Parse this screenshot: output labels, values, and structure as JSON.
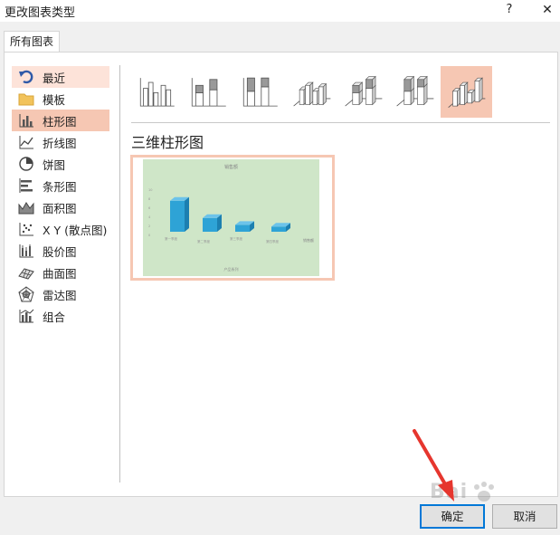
{
  "window": {
    "title": "更改图表类型",
    "help_label": "?",
    "close_label": "✕"
  },
  "tab": {
    "label": "所有图表"
  },
  "sidebar": {
    "items": [
      {
        "label": "最近",
        "icon": "undo-arrow-icon",
        "state": "hover"
      },
      {
        "label": "模板",
        "icon": "folder-icon",
        "state": "normal"
      },
      {
        "label": "柱形图",
        "icon": "column-chart-icon",
        "state": "selected"
      },
      {
        "label": "折线图",
        "icon": "line-chart-icon",
        "state": "normal"
      },
      {
        "label": "饼图",
        "icon": "pie-chart-icon",
        "state": "normal"
      },
      {
        "label": "条形图",
        "icon": "bar-chart-icon",
        "state": "normal"
      },
      {
        "label": "面积图",
        "icon": "area-chart-icon",
        "state": "normal"
      },
      {
        "label": "X Y (散点图)",
        "icon": "scatter-chart-icon",
        "state": "normal"
      },
      {
        "label": "股价图",
        "icon": "stock-chart-icon",
        "state": "normal"
      },
      {
        "label": "曲面图",
        "icon": "surface-chart-icon",
        "state": "normal"
      },
      {
        "label": "雷达图",
        "icon": "radar-chart-icon",
        "state": "normal"
      },
      {
        "label": "组合",
        "icon": "combo-chart-icon",
        "state": "normal"
      }
    ]
  },
  "subtypes": [
    {
      "icon": "clustered-column-icon"
    },
    {
      "icon": "stacked-column-icon"
    },
    {
      "icon": "100-stacked-column-icon"
    },
    {
      "icon": "3d-clustered-column-icon"
    },
    {
      "icon": "3d-stacked-column-icon"
    },
    {
      "icon": "3d-100-stacked-column-icon"
    },
    {
      "icon": "3d-column-icon",
      "selected": true
    }
  ],
  "main": {
    "type_title": "三维柱形图"
  },
  "preview": {
    "background": "#cfe6c8",
    "bar_color": "#2ea3d6",
    "title": "销售额",
    "axis_title": "产品系列",
    "legend": "销售额",
    "ticks": [
      "10",
      "8",
      "6",
      "4",
      "2",
      "0"
    ],
    "categories": [
      "第一季度",
      "第二季度",
      "第三季度",
      "第四季度"
    ],
    "values": [
      9,
      4,
      2,
      1.5
    ]
  },
  "buttons": {
    "ok_label": "确定",
    "cancel_label": "取消"
  },
  "watermark": "Bai 经验",
  "colors": {
    "accent": "#0078d7",
    "selection": "#f6c7b3",
    "hover": "#fde3d9",
    "arrow": "#e6362e"
  }
}
